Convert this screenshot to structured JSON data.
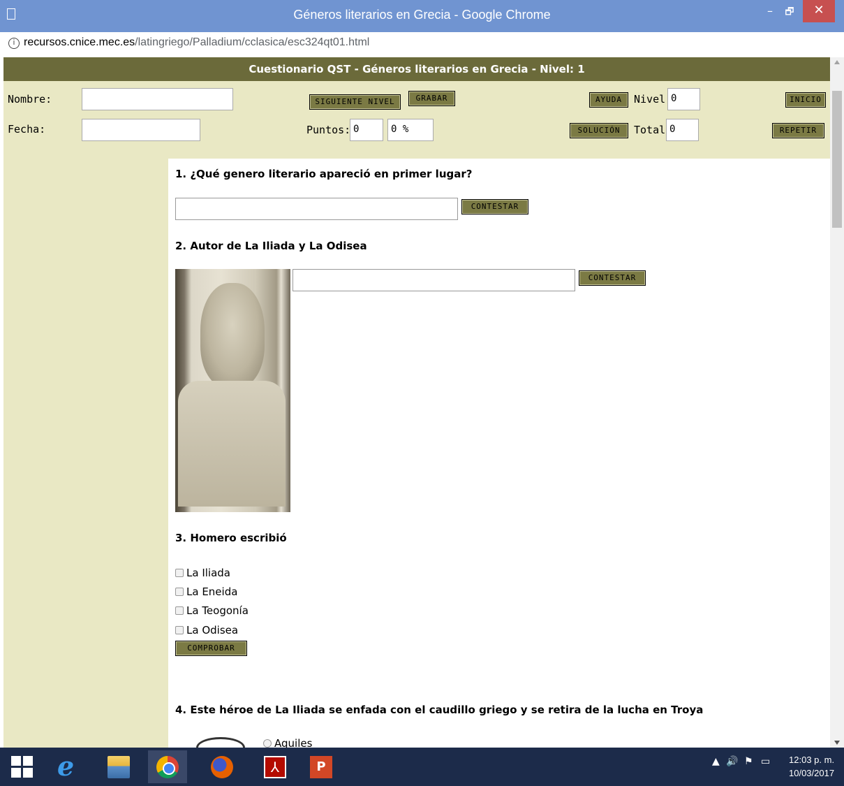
{
  "window": {
    "title": "Géneros literarios en Grecia - Google Chrome",
    "minimize_glyph": "–",
    "maximize_glyph": "🗗",
    "close_glyph": "✕"
  },
  "address": {
    "info_glyph": "i",
    "host": "recursos.cnice.mec.es",
    "path": "/latingriego/Palladium/cclasica/esc324qt01.html"
  },
  "header": {
    "title": "Cuestionario QST - Géneros literarios en Grecia - Nivel: 1"
  },
  "form": {
    "nombre_label": "Nombre:",
    "nombre_value": "",
    "fecha_label": "Fecha:",
    "fecha_value": "",
    "siguiente_nivel_label": "SIGUIENTE NIVEL",
    "grabar_label": "GRABAR",
    "ayuda_label": "AYUDA",
    "nivel_label": "Nivel:",
    "nivel_value": "0",
    "inicio_label": "INICIO",
    "puntos_label": "Puntos:",
    "puntos_value": "0",
    "percent_value": "0 %",
    "solucion_label": "SOLUCIÓN",
    "total_label": "Total:",
    "total_value": "0",
    "repetir_label": "REPETIR"
  },
  "questions": {
    "q1": {
      "text": "1. ¿Qué genero literario apareció en primer lugar?",
      "answer": "",
      "button": "CONTESTAR"
    },
    "q2": {
      "text": "2. Autor de La Iliada y La Odisea",
      "answer": "",
      "button": "CONTESTAR"
    },
    "q3": {
      "text": "3. Homero escribió",
      "options": [
        "La Iliada",
        "La Eneida",
        "La Teogonía",
        "La Odisea"
      ],
      "button": "COMPROBAR"
    },
    "q4": {
      "text": "4. Este héroe de La Iliada se enfada con el caudillo griego y se retira de la lucha en Troya",
      "first_option": "Aquiles"
    }
  },
  "taskbar": {
    "ie_glyph": "e",
    "acrobat_glyph": "⅄",
    "ppt_glyph": "P",
    "time": "12:03 p. m.",
    "date": "10/03/2017"
  }
}
